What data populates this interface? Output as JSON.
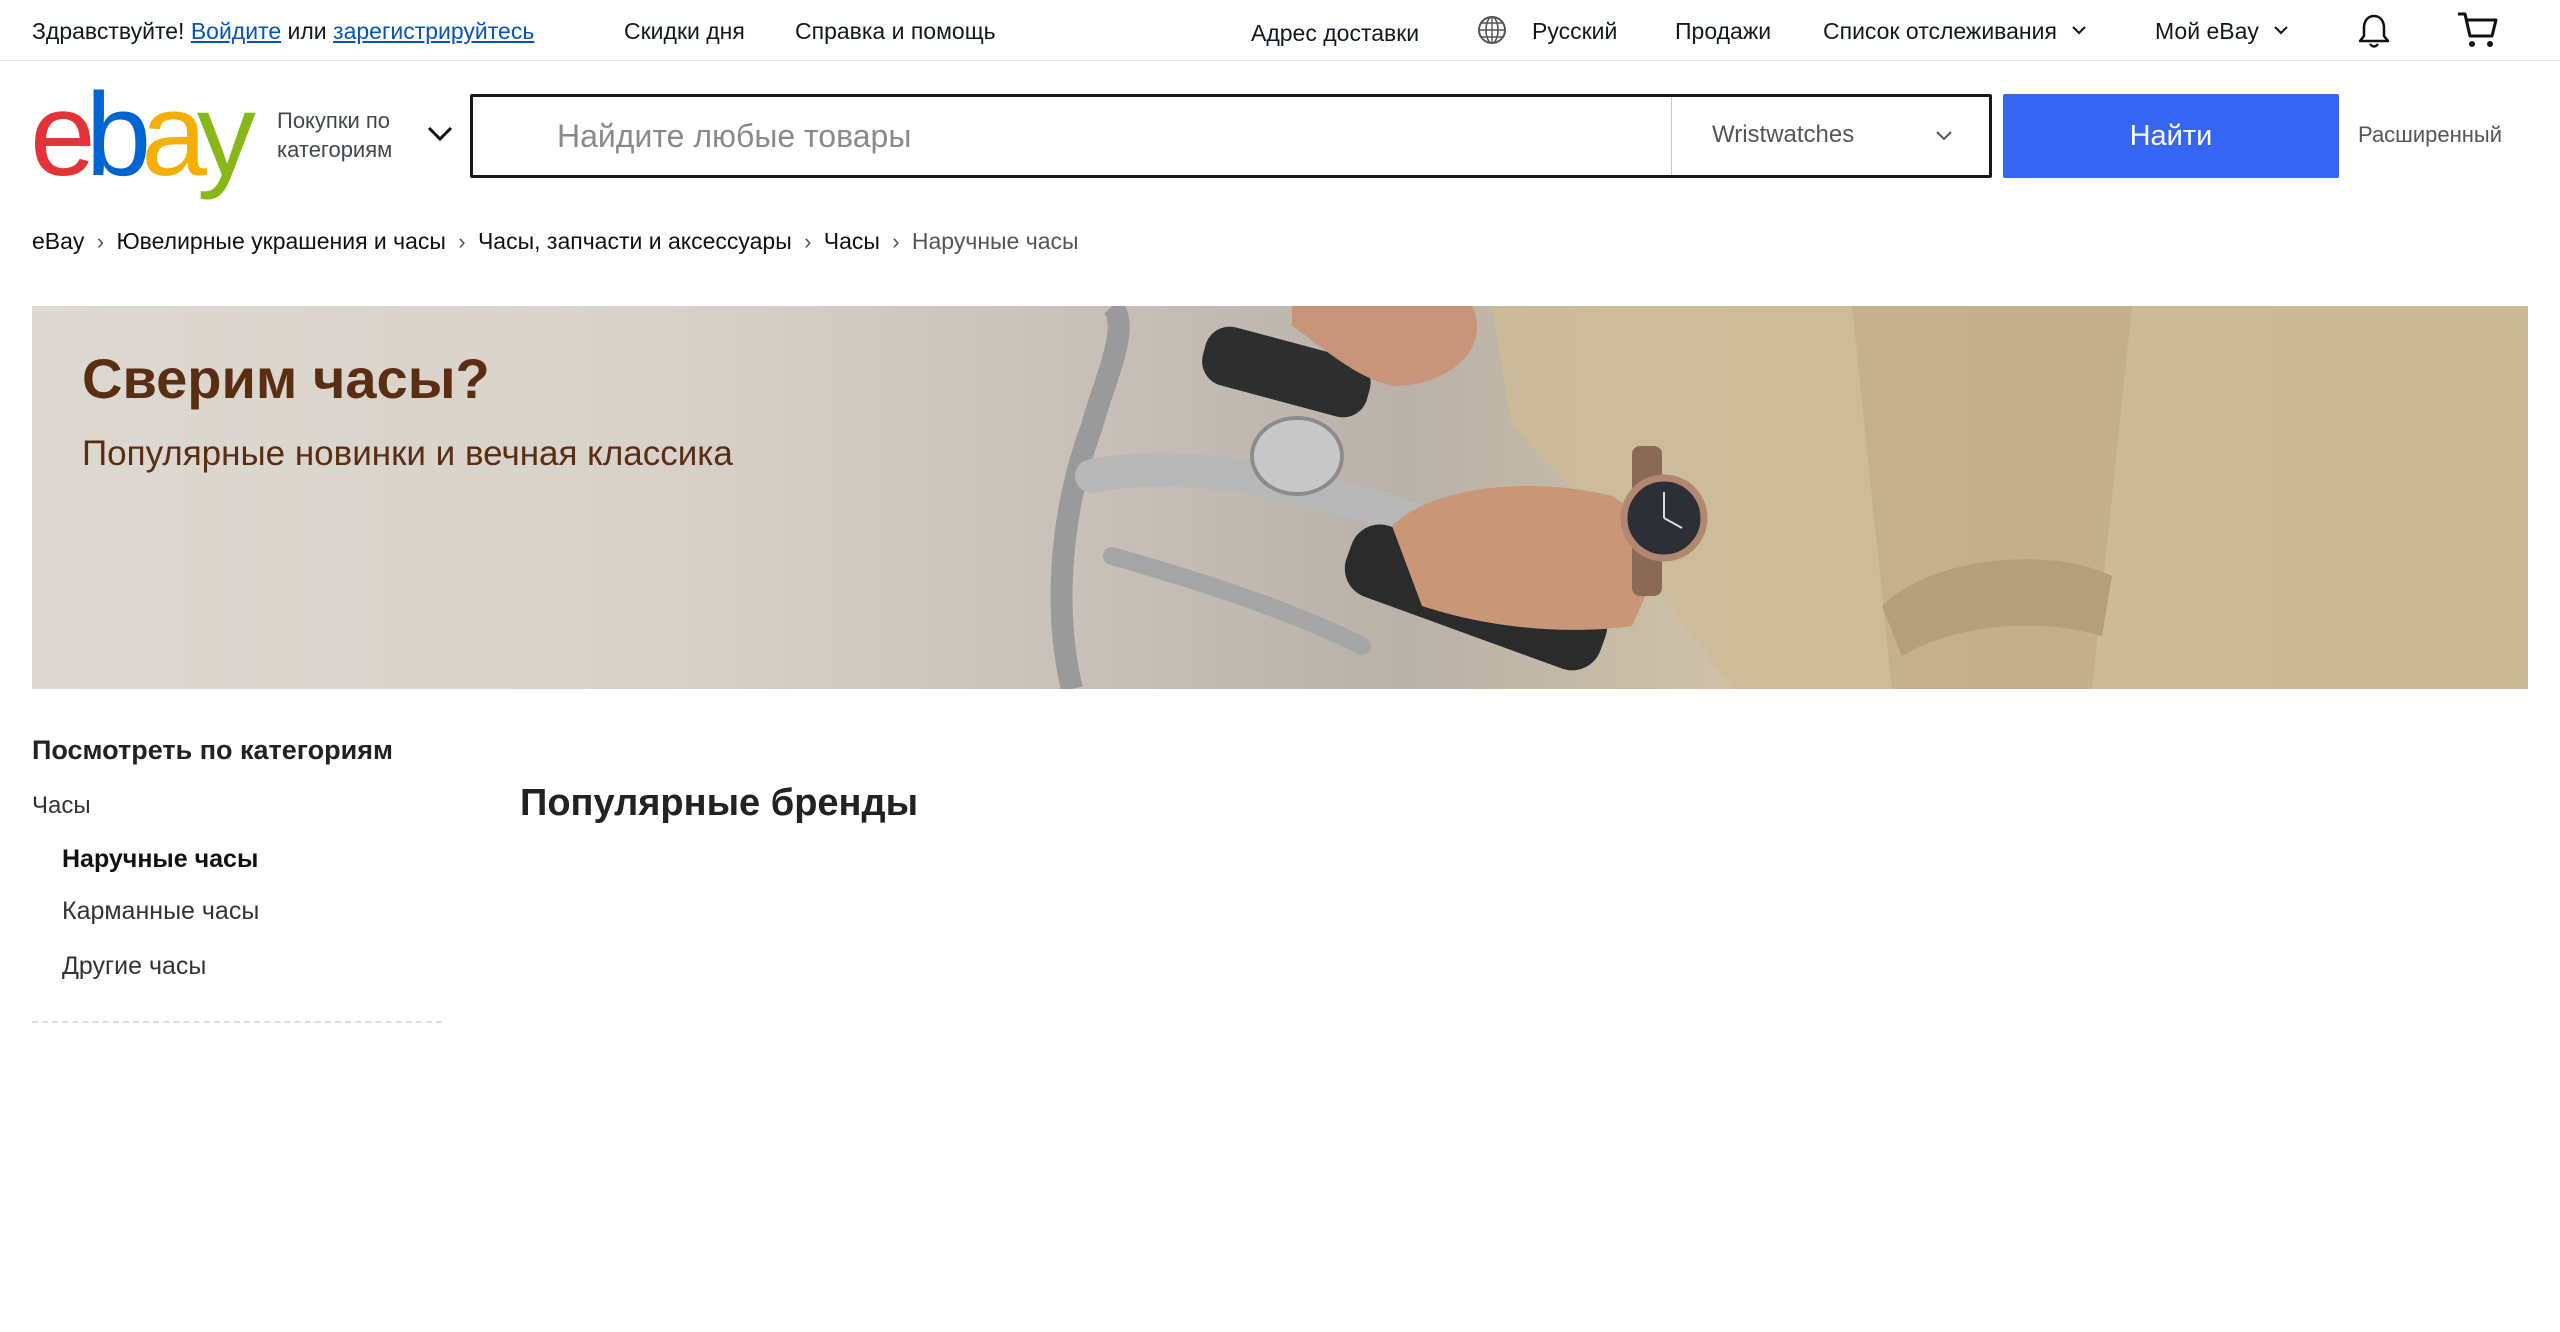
{
  "topbar": {
    "greeting": "Здравствуйте!",
    "signin_link": "Войдите",
    "or_text": "или",
    "register_link": "зарегистрируйтесь",
    "daily_deals": "Скидки дня",
    "help": "Справка и помощь",
    "ship_to": "Адрес доставки",
    "language": "Русский",
    "selling": "Продажи",
    "watchlist": "Список отслеживания",
    "my_ebay": "Мой eBay"
  },
  "header": {
    "logo": "ebay",
    "shop_by_category": "Покупки по категориям",
    "search": {
      "placeholder": "Найдите любые товары",
      "value": "",
      "category_selected": "Wristwatches"
    },
    "search_button": "Найти",
    "advanced": "Расширенный"
  },
  "breadcrumb": [
    "eBay",
    "Ювелирные украшения и часы",
    "Часы, запчасти и аксессуары",
    "Часы",
    "Наручные часы"
  ],
  "hero": {
    "title": "Сверим часы?",
    "subtitle": "Популярные новинки и вечная классика"
  },
  "sidebar": {
    "title": "Посмотреть по категориям",
    "root": "Часы",
    "children": [
      {
        "label": "Наручные часы",
        "active": true
      },
      {
        "label": "Карманные часы",
        "active": false
      },
      {
        "label": "Другие часы",
        "active": false
      }
    ]
  },
  "main": {
    "section_title": "Популярные бренды"
  },
  "colors": {
    "link": "#0654ba",
    "primary_button": "#3665f3",
    "hero_text": "#5a2e12"
  }
}
